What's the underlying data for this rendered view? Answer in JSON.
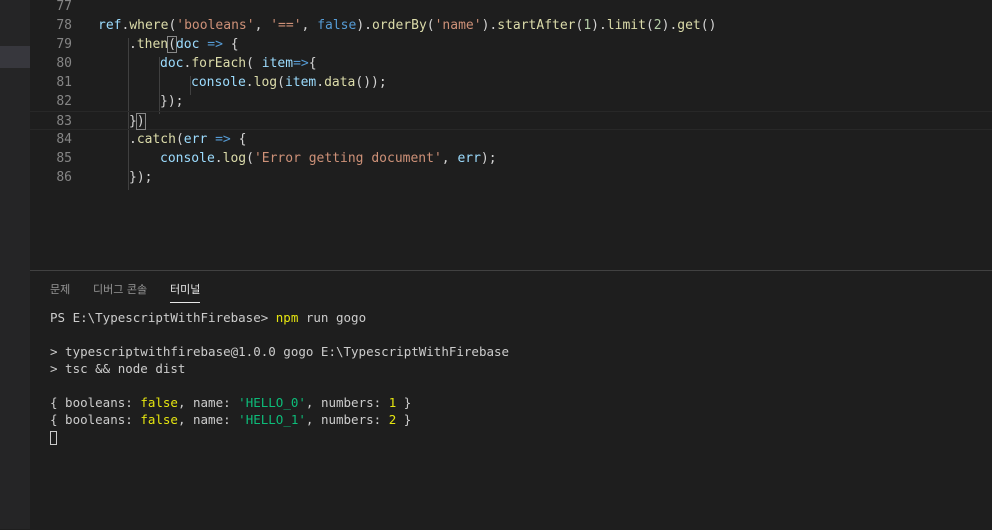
{
  "editor": {
    "line_numbers": [
      "77",
      "78",
      "79",
      "80",
      "81",
      "82",
      "83",
      "84",
      "85",
      "86"
    ],
    "l78": {
      "a": "ref",
      "b": ".",
      "c": "where",
      "d": "(",
      "e": "'booleans'",
      "f": ", ",
      "g": "'=='",
      "h": ", ",
      "i": "false",
      "j": ").",
      "k": "orderBy",
      "l": "(",
      "m": "'name'",
      "n": ").",
      "o": "startAfter",
      "p": "(",
      "q": "1",
      "r": ").",
      "s": "limit",
      "t": "(",
      "u": "2",
      "v": ").",
      "w": "get",
      "x": "()"
    },
    "l79": {
      "a": ".",
      "b": "then",
      "c": "(",
      "d": "doc",
      "e": " ",
      "f": "=>",
      "g": " {"
    },
    "l80": {
      "a": "doc",
      "b": ".",
      "c": "forEach",
      "d": "( ",
      "e": "item",
      "f": "=>",
      "g": "{"
    },
    "l81": {
      "a": "console",
      "b": ".",
      "c": "log",
      "d": "(",
      "e": "item",
      "f": ".",
      "g": "data",
      "h": "());"
    },
    "l82": {
      "a": "});"
    },
    "l83": {
      "a": "}",
      "b": ")"
    },
    "l84": {
      "a": ".",
      "b": "catch",
      "c": "(",
      "d": "err",
      "e": " ",
      "f": "=>",
      "g": " {"
    },
    "l85": {
      "a": "console",
      "b": ".",
      "c": "log",
      "d": "(",
      "e": "'Error getting document'",
      "f": ", ",
      "g": "err",
      "h": ");"
    },
    "l86": {
      "a": "});"
    }
  },
  "panel": {
    "tabs": [
      "문제",
      "디버그 콘솔",
      "터미널"
    ],
    "active_tab": "터미널"
  },
  "terminal": {
    "line1": {
      "prompt": "PS E:\\TypescriptWithFirebase> ",
      "cmd": "npm",
      "args": " run gogo"
    },
    "line2": "> typescriptwithfirebase@1.0.0 gogo E:\\TypescriptWithFirebase",
    "line3": "> tsc && node dist",
    "out1": {
      "a": "{ booleans: ",
      "b": "false",
      "c": ", name: ",
      "d": "'HELLO_0'",
      "e": ", numbers: ",
      "f": "1",
      "g": " }"
    },
    "out2": {
      "a": "{ booleans: ",
      "b": "false",
      "c": ", name: ",
      "d": "'HELLO_1'",
      "e": ", numbers: ",
      "f": "2",
      "g": " }"
    }
  }
}
